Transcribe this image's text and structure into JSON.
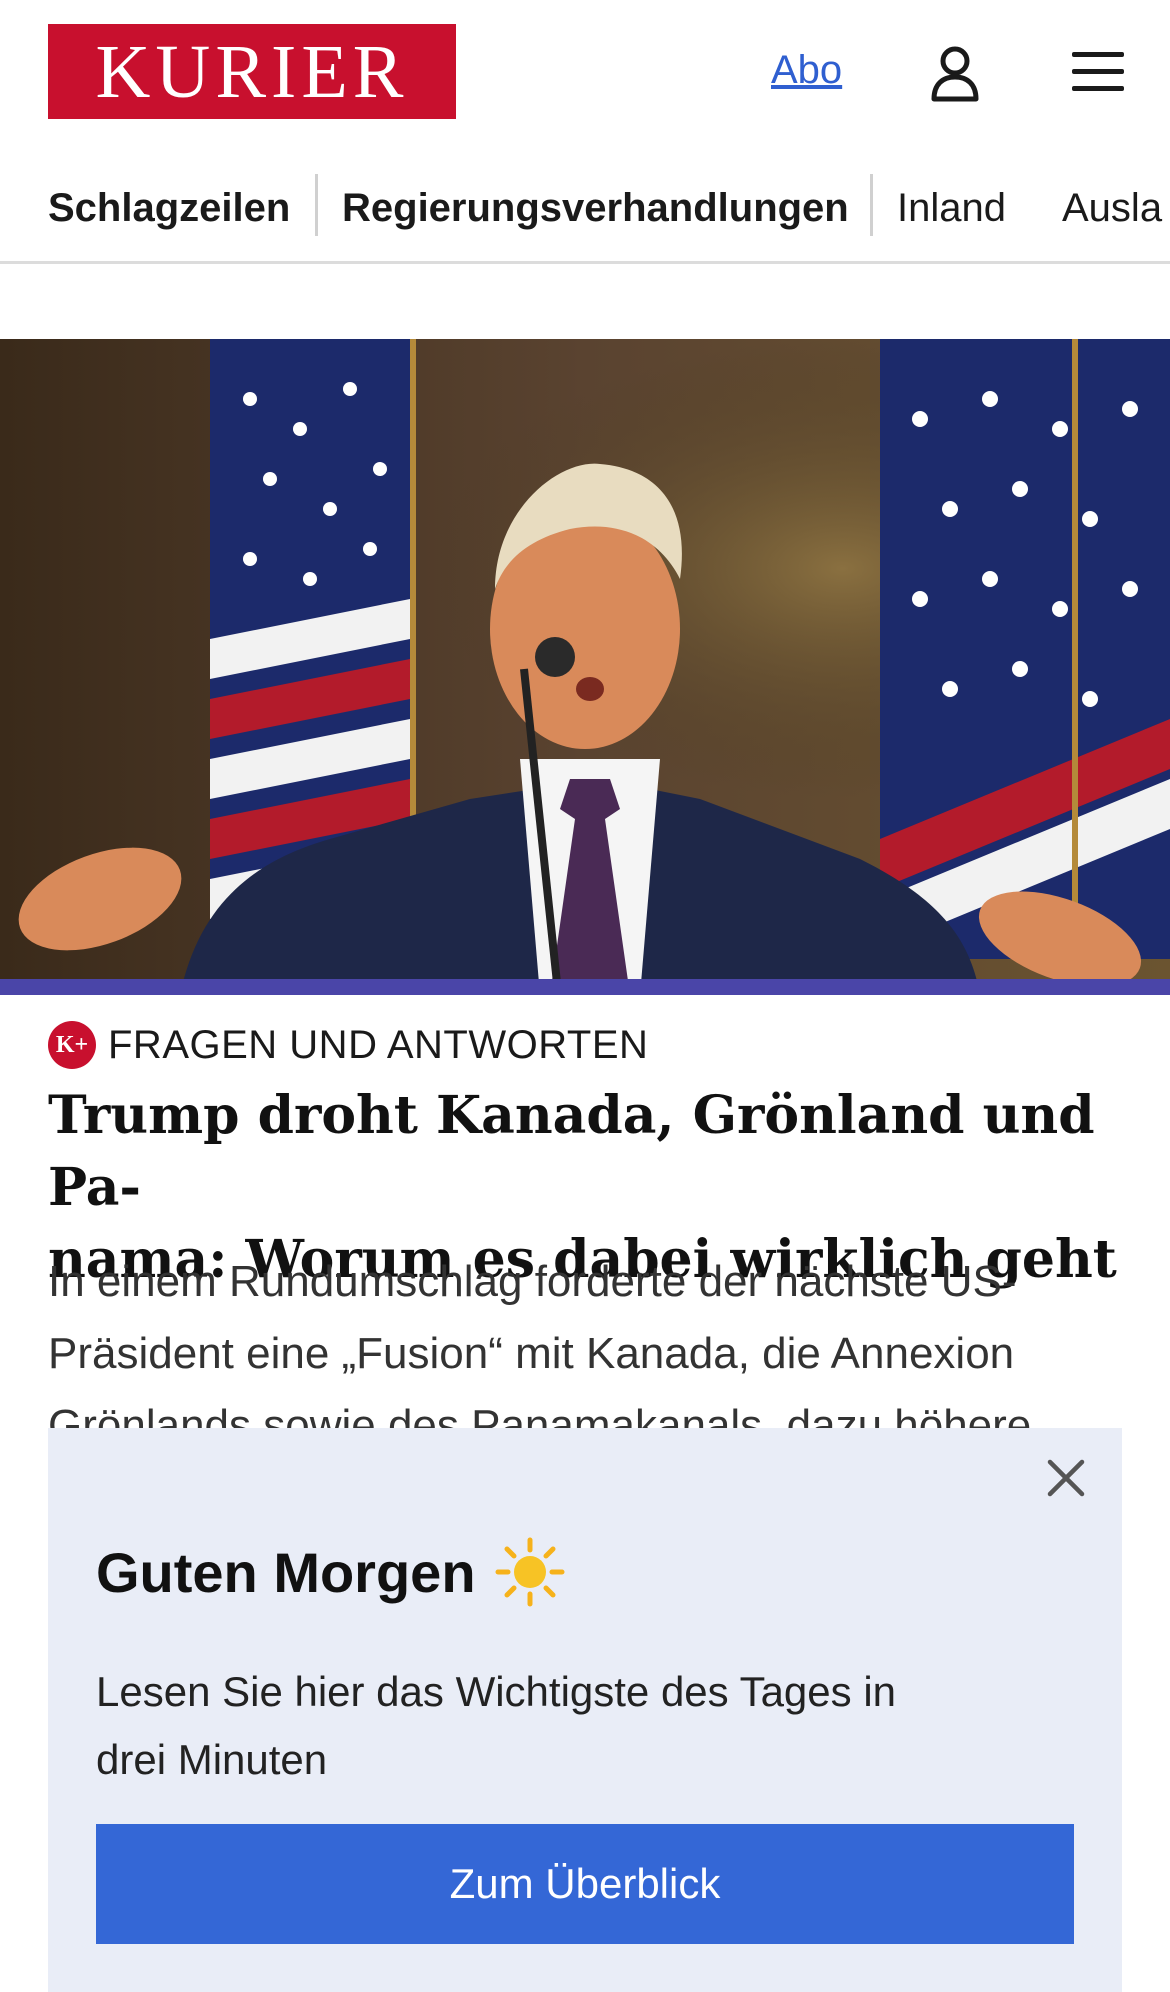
{
  "header": {
    "logo_text": "KURIER",
    "abo_link": "Abo",
    "user_icon": "user-icon",
    "menu_icon": "hamburger-menu-icon"
  },
  "nav": {
    "items": [
      {
        "label": "Schlagzeilen",
        "bold": true
      },
      {
        "label": "Regierungsverhandlungen",
        "bold": true
      },
      {
        "label": "Inland",
        "bold": false
      },
      {
        "label": "Ausla",
        "bold": false
      }
    ]
  },
  "article": {
    "badge_icon": "k-plus-premium-icon",
    "badge_text": "K+",
    "kicker": "FRAGEN UND ANTWORTEN",
    "headline_line1": "Trump droht Kanada, Grönland und Pa-",
    "headline_line2": "nama: Worum es dabei wirklich geht",
    "teaser_line1": "In einem Rundumschlag forderte der nächste US-",
    "teaser_line2": "Präsident eine „Fusion“ mit Kanada, die Annexion",
    "teaser_line3": "Grönlands sowie des Panamakanals, dazu höhere"
  },
  "popup": {
    "title": "Guten Morgen",
    "title_icon": "sun-icon",
    "body_line1": "Lesen Sie hier das Wichtigste des Tages in",
    "body_line2": "drei Minuten",
    "button_label": "Zum Überblick",
    "close_icon": "close-icon"
  },
  "colors": {
    "brand_red": "#c8102e",
    "link_blue": "#2f5fd0",
    "button_blue": "#3467d6",
    "popup_bg": "#e9edf7"
  }
}
